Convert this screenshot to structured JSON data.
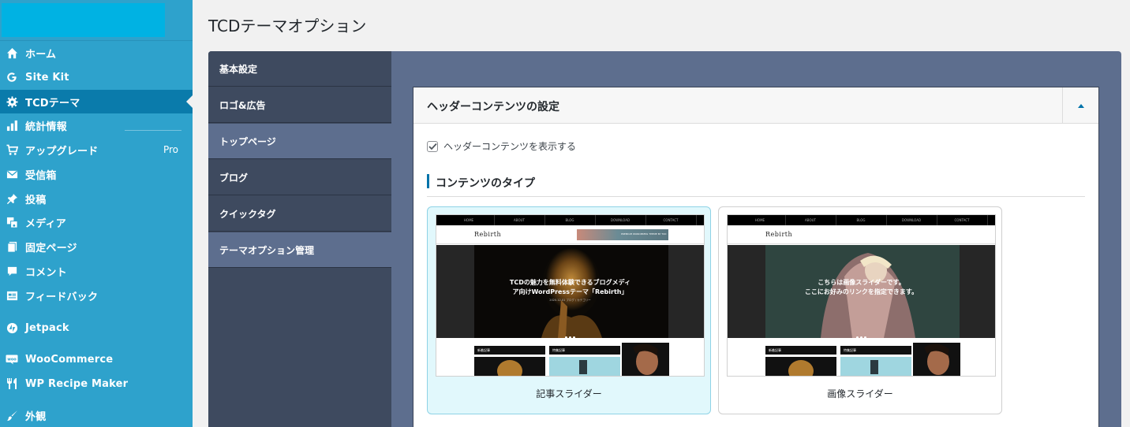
{
  "sidebar": {
    "items": [
      {
        "label": "ホーム",
        "icon": "home-icon"
      },
      {
        "label": "Site Kit",
        "icon": "google-icon"
      },
      {
        "label": "TCDテーマ",
        "icon": "gear-icon",
        "current": true
      },
      {
        "label": "統計情報",
        "icon": "bar-chart-icon"
      },
      {
        "label": "アップグレード",
        "icon": "cart-icon",
        "badge": "Pro"
      },
      {
        "label": "受信箱",
        "icon": "mail-icon"
      },
      {
        "label": "投稿",
        "icon": "pin-icon"
      },
      {
        "label": "メディア",
        "icon": "media-icon"
      },
      {
        "label": "固定ページ",
        "icon": "pages-icon"
      },
      {
        "label": "コメント",
        "icon": "comment-icon"
      },
      {
        "label": "フィードバック",
        "icon": "feedback-icon"
      },
      {
        "label": "Jetpack",
        "icon": "jetpack-icon"
      },
      {
        "label": "WooCommerce",
        "icon": "woo-icon"
      },
      {
        "label": "WP Recipe Maker",
        "icon": "fork-knife-icon"
      },
      {
        "label": "外観",
        "icon": "brush-icon"
      }
    ]
  },
  "page": {
    "title": "TCDテーマオプション"
  },
  "tabs": [
    {
      "label": "基本設定"
    },
    {
      "label": "ロゴ&広告"
    },
    {
      "label": "トップページ",
      "active": true
    },
    {
      "label": "ブログ"
    },
    {
      "label": "クイックタグ"
    },
    {
      "label": "テーマオプション管理"
    }
  ],
  "header_settings": {
    "title": "ヘッダーコンテンツの設定",
    "show_checkbox_label": "ヘッダーコンテンツを表示する",
    "show_checked": true,
    "section_title": "コンテンツのタイプ",
    "types": [
      {
        "label": "記事スライダー",
        "selected": true,
        "preview": {
          "nav": [
            "HOME",
            "ABOUT",
            "BLOG",
            "DOWNLOAD",
            "CONTACT"
          ],
          "logo": "Rebirth",
          "banner_text": "PREMIUM WORDPRESS THEME BY TCD",
          "hero_line1": "TCDの魅力を無料体験できるブログメディ",
          "hero_line2": "ア向けWordPressテーマ「Rebirth」",
          "hero_sub": "2020.12.01 ブログ / カテゴリー",
          "card1_title": "新着記事",
          "card2_title": "特集記事"
        }
      },
      {
        "label": "画像スライダー",
        "selected": false,
        "preview": {
          "nav": [
            "HOME",
            "ABOUT",
            "BLOG",
            "DOWNLOAD",
            "CONTACT"
          ],
          "logo": "Rebirth",
          "hero_line1": "こちらは画像スライダーです。",
          "hero_line2": "ここにお好みのリンクを指定できます。",
          "card1_title": "新着記事",
          "card2_title": "特集記事"
        }
      }
    ]
  },
  "colors": {
    "sidebar_bg": "#2ea2cc",
    "sidebar_current": "#0a7bab",
    "panel_bg": "#5d6e8e",
    "tab_bg": "#3e4a5f",
    "accent": "#0073aa",
    "selected_card": "#e1f8fc"
  }
}
